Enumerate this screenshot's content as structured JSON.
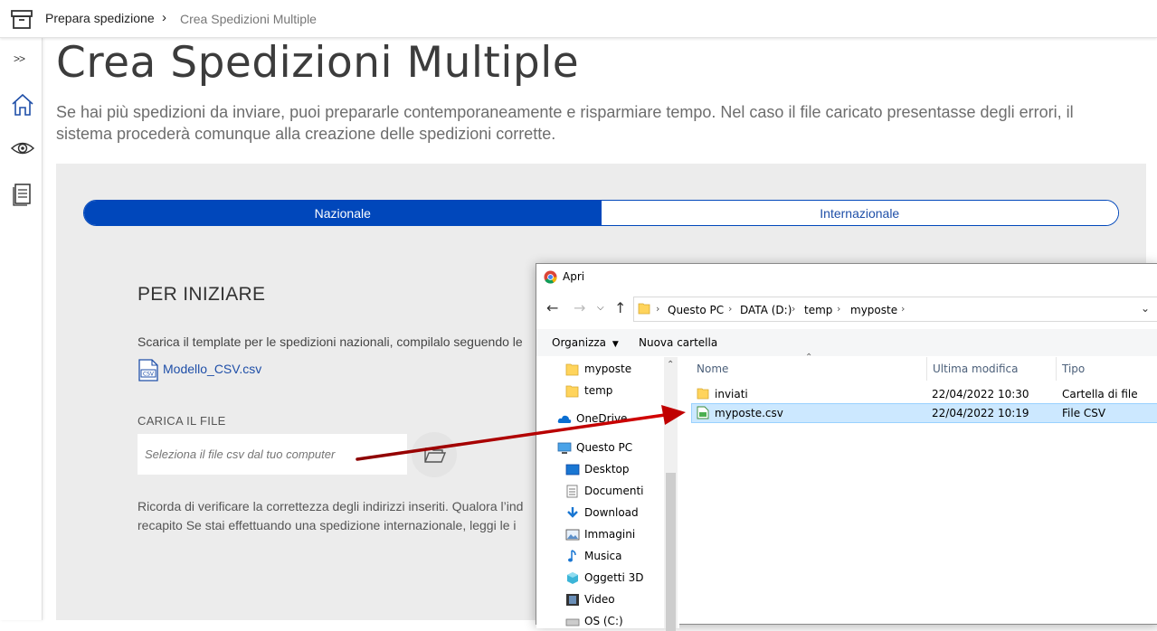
{
  "header": {
    "breadcrumb_parent": "Prepara spedizione",
    "breadcrumb_current": "Crea Spedizioni Multiple"
  },
  "sidebar": {
    "expand_label": ">>",
    "icons": [
      "home-icon",
      "eye-icon",
      "document-icon"
    ]
  },
  "main": {
    "title": "Crea Spedizioni Multiple",
    "description": "Se hai più spedizioni da inviare, puoi prepararle contemporaneamente e risparmiare tempo. Nel caso il file caricato presentasse degli errori, il sistema procederà comunque alla creazione delle spedizioni corrette.",
    "tabs": [
      {
        "label": "Nazionale",
        "active": true
      },
      {
        "label": "Internazionale",
        "active": false
      }
    ],
    "start_title": "PER INIZIARE",
    "template_text": "Scarica il template per le spedizioni nazionali, compilalo seguendo le",
    "template_link": "Modello_CSV.csv",
    "upload_label": "CARICA IL FILE",
    "file_input_placeholder": "Seleziona il file csv dal tuo computer",
    "reminder_line1": "Ricorda di verificare la correttezza degli indirizzi inseriti. Qualora l’ind",
    "reminder_line2": "recapito Se stai effettuando una spedizione internazionale, leggi le i"
  },
  "dialog": {
    "title": "Apri",
    "address": [
      "Questo PC",
      "DATA (D:)",
      "temp",
      "myposte"
    ],
    "toolbar": {
      "organize": "Organizza",
      "new_folder": "Nuova cartella"
    },
    "nav_items": [
      {
        "label": "myposte",
        "icon": "folder-icon"
      },
      {
        "label": "temp",
        "icon": "folder-icon"
      },
      {
        "label": "OneDrive",
        "icon": "cloud-icon"
      },
      {
        "label": "Questo PC",
        "icon": "computer-icon"
      },
      {
        "label": "Desktop",
        "icon": "desktop-icon"
      },
      {
        "label": "Documenti",
        "icon": "documents-icon"
      },
      {
        "label": "Download",
        "icon": "download-icon"
      },
      {
        "label": "Immagini",
        "icon": "pictures-icon"
      },
      {
        "label": "Musica",
        "icon": "music-icon"
      },
      {
        "label": "Oggetti 3D",
        "icon": "objects-3d-icon"
      },
      {
        "label": "Video",
        "icon": "video-icon"
      },
      {
        "label": "OS (C:)",
        "icon": "drive-icon"
      }
    ],
    "columns": {
      "name": "Nome",
      "modified": "Ultima modifica",
      "type": "Tipo"
    },
    "files": [
      {
        "name": "inviati",
        "modified": "22/04/2022 10:30",
        "type": "Cartella di file",
        "icon": "folder-icon",
        "selected": false
      },
      {
        "name": "myposte.csv",
        "modified": "22/04/2022 10:19",
        "type": "File CSV",
        "icon": "csv-file-icon",
        "selected": true
      }
    ]
  },
  "colors": {
    "accent": "#0047bb",
    "annotation_arrow": "#c00000",
    "selection": "#cce8ff"
  }
}
